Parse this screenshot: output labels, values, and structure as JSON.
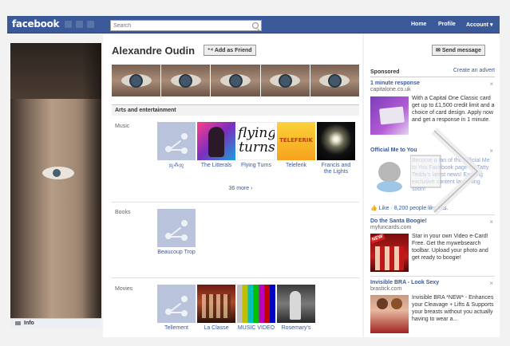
{
  "topbar": {
    "logo": "facebook",
    "search_placeholder": "Search",
    "nav": [
      "Home",
      "Profile",
      "Account ▾"
    ]
  },
  "profile": {
    "name": "Alexandre Oudin",
    "add_friend_label": "Add as Friend",
    "send_message_label": "Send message",
    "info_tab": "Info"
  },
  "likes": {
    "section_title": "Arts and entertainment",
    "categories": [
      {
        "label": "Music",
        "items": [
          "ஜ⁂ஜ",
          "The Litterals",
          "Flying Turns",
          "Teleferik",
          "Francis and the Lights"
        ],
        "more_link": "36 more ›"
      },
      {
        "label": "Books",
        "items": [
          "Beaucoup Trop"
        ]
      },
      {
        "label": "Movies",
        "items": [
          "Tellement",
          "La Classe",
          "MUSIC VIDEO",
          "Rosemary's"
        ]
      }
    ],
    "thumb_texts": {
      "flying_turns": "flying turns",
      "teleferik": "TELEFERIK"
    }
  },
  "sidebar": {
    "sponsored_title": "Sponsored",
    "create_advert": "Create an advert",
    "close_glyph": "×",
    "ads": [
      {
        "title": "1 minute response",
        "url": "capitalone.co.uk",
        "text": "With a Capital One Classic card get up to £1,500 credit limit and a choice of card design. Apply now and get a response in 1 minute."
      },
      {
        "title": "Official Me to You",
        "url": "",
        "text": "Become a fan of the Official Me to You Facebook page for Tatty Teddy's latest news! Exciting exclusive content launching soon!",
        "like_text": "Like · 8,200 people like this."
      },
      {
        "title": "Do the Santa Boogie!",
        "url": "myfuncards.com",
        "text": "Star in your own Video e-Card! Free. Get the mywebsearch toolbar. Upload your photo and get ready to boogie!",
        "badge": "NEW"
      },
      {
        "title": "Invisible BRA - Look Sexy",
        "url": "brastick.com",
        "text": "Invisible BRA *NEW* - Enhances your Cleavage + Lifts & Supports your breasts without you actually having to wear a..."
      }
    ]
  },
  "colors": {
    "facebook_blue": "#3b5998",
    "link_blue": "#3b5998",
    "placeholder_blue": "#b9c4dc"
  }
}
